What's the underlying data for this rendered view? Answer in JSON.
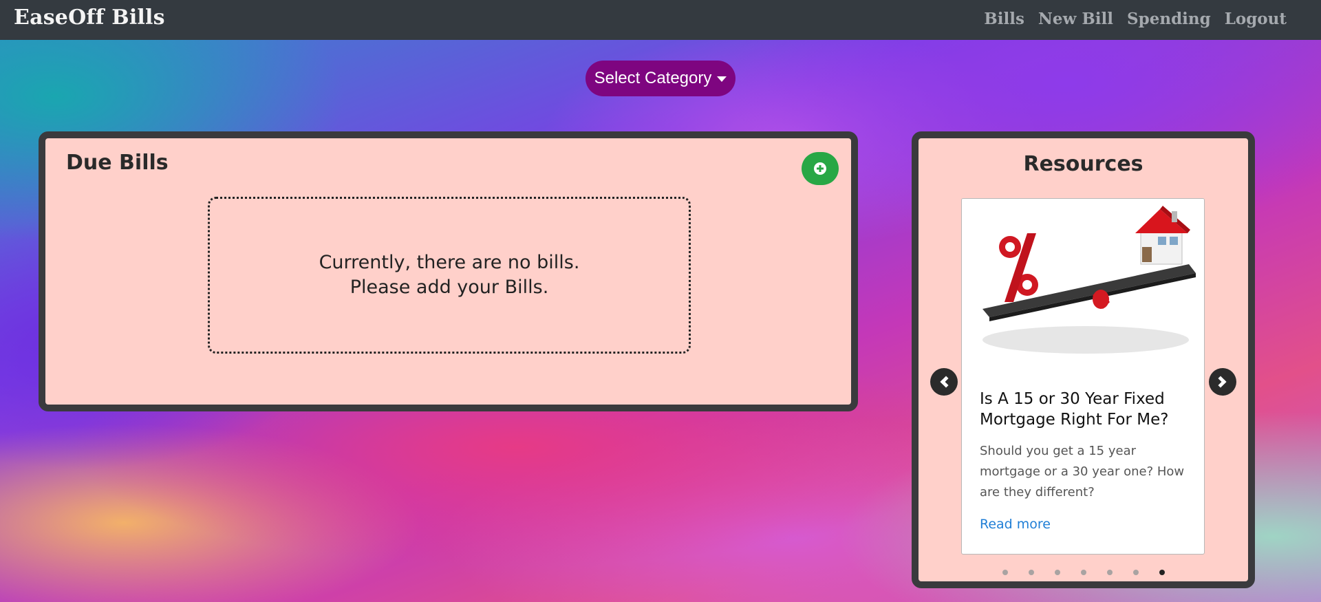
{
  "navbar": {
    "brand": "EaseOff Bills",
    "links": [
      "Bills",
      "New Bill",
      "Spending",
      "Logout"
    ]
  },
  "category_dropdown": {
    "label": "Select Category"
  },
  "due_bills": {
    "title": "Due Bills",
    "empty_line1": "Currently, there are no bills.",
    "empty_line2": "Please add your Bills."
  },
  "resources": {
    "title": "Resources",
    "card": {
      "title": "Is A 15 or 30 Year Fixed Mortgage Right For Me?",
      "text": "Should you get a 15 year mortgage or a 30 year one? How are they different?",
      "link": "Read more"
    },
    "carousel": {
      "total_slides": 7,
      "active_index": 6
    }
  },
  "colors": {
    "navbar": "#343a40",
    "panel_bg": "#ffd0ca",
    "panel_border": "#3a3a3d",
    "dropdown": "#7e0580",
    "add_button": "#28a745",
    "link": "#1f7ed6"
  }
}
